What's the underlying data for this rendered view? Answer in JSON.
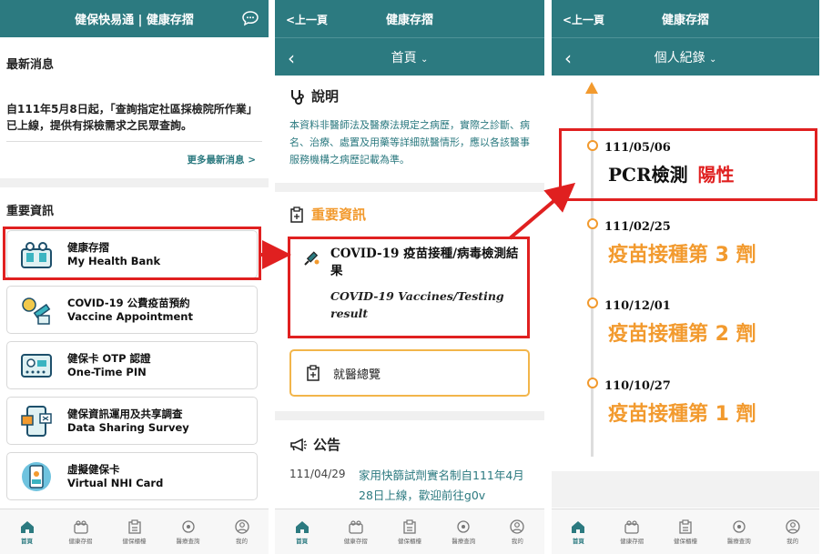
{
  "panel1": {
    "header_title": "健保快易通 | 健康存摺",
    "news_title": "最新消息",
    "news_text": "自111年5月8日起，「查詢指定社區採檢院所作業」已上線，提供有採檢需求之民眾查詢。",
    "more_news": "更多最新消息 >",
    "important_title": "重要資訊",
    "cards": [
      {
        "title": "健康存摺",
        "subtitle": "My Health Bank"
      },
      {
        "title": "COVID-19 公費疫苗預約",
        "subtitle": "Vaccine Appointment"
      },
      {
        "title": "健保卡 OTP 認證",
        "subtitle": "One-Time PIN"
      },
      {
        "title": "健保資訊運用及共享調查",
        "subtitle": "Data Sharing Survey"
      },
      {
        "title": "虛擬健保卡",
        "subtitle": "Virtual NHI Card"
      }
    ]
  },
  "panel2": {
    "back_label": "<上一頁",
    "header_title": "健康存摺",
    "nav_title": "首頁",
    "explain_title": "說明",
    "explain_text": "本資料非醫師法及醫療法規定之病歷，實際之診斷、病名、治療、處置及用藥等詳細就醫情形，應以各該醫事服務機構之病歷記載為準。",
    "important_title": "重要資訊",
    "covid_title": "COVID-19 疫苗接種/病毒檢測結果",
    "covid_subtitle": "COVID-19 Vaccines/Testing result",
    "medical_summary": "就醫總覽",
    "announce_title": "公告",
    "announce_date": "111/04/29",
    "announce_text": "家用快篩試劑實名制自111年4月28日上線，歡迎前往g0v"
  },
  "panel3": {
    "back_label": "<上一頁",
    "header_title": "健康存摺",
    "nav_title": "個人紀錄",
    "records": [
      {
        "date": "111/05/06",
        "label": "PCR檢測",
        "result": "陽性"
      },
      {
        "date": "111/02/25",
        "label": "疫苗接種第 3 劑"
      },
      {
        "date": "110/12/01",
        "label": "疫苗接種第 2 劑"
      },
      {
        "date": "110/10/27",
        "label": "疫苗接種第 1 劑"
      }
    ]
  },
  "tabs": [
    "首頁",
    "健康存摺",
    "健保櫃檯",
    "醫療查詢",
    "我的"
  ],
  "colors": {
    "teal": "#2c7a80",
    "orange": "#f29a2e",
    "highlight_red": "#e02020"
  }
}
